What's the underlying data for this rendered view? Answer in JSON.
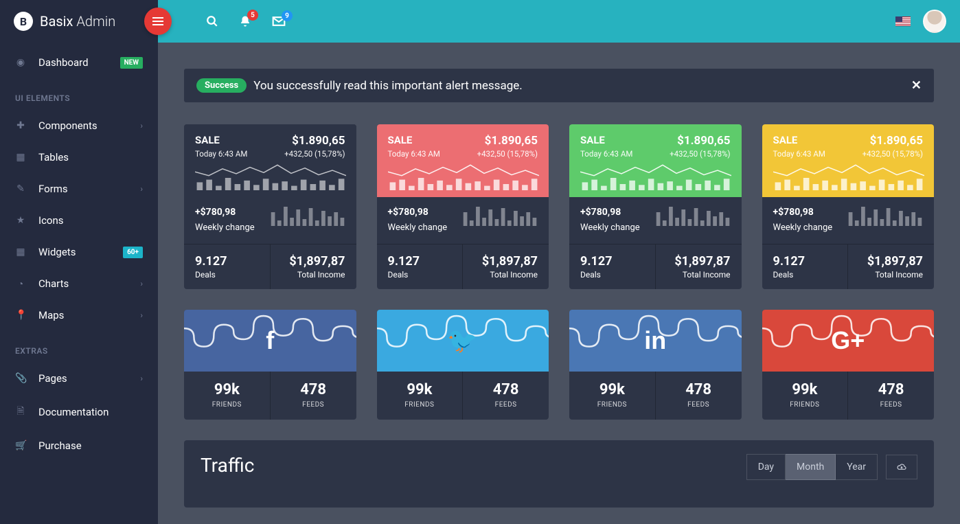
{
  "brand": {
    "name_bold": "Basix",
    "name_thin": "Admin"
  },
  "sidebar": {
    "items": [
      {
        "icon": "gauge-icon",
        "label": "Dashboard",
        "badge": "NEW",
        "badge_class": "badge-new",
        "chev": false
      }
    ],
    "section_ui": "UI ELEMENTS",
    "ui_items": [
      {
        "icon": "puzzle-icon",
        "label": "Components",
        "chev": true
      },
      {
        "icon": "table-icon",
        "label": "Tables",
        "chev": false
      },
      {
        "icon": "edit-icon",
        "label": "Forms",
        "chev": true
      },
      {
        "icon": "star-icon",
        "label": "Icons",
        "chev": false
      },
      {
        "icon": "grid-icon",
        "label": "Widgets",
        "badge": "60+",
        "badge_class": "badge-60",
        "chev": false
      },
      {
        "icon": "pie-icon",
        "label": "Charts",
        "chev": true
      },
      {
        "icon": "pin-icon",
        "label": "Maps",
        "chev": true
      }
    ],
    "section_extras": "EXTRAS",
    "extras_items": [
      {
        "icon": "clip-icon",
        "label": "Pages",
        "chev": true
      },
      {
        "icon": "doc-icon",
        "label": "Documentation",
        "chev": false
      },
      {
        "icon": "cart-icon",
        "label": "Purchase",
        "chev": false
      }
    ]
  },
  "topbar": {
    "notif_count": "5",
    "mail_count": "9"
  },
  "alert": {
    "pill": "Success",
    "text": "You successfully read this important alert message."
  },
  "sale": {
    "title": "SALE",
    "amount": "$1.890,65",
    "time": "Today 6:43 AM",
    "delta": "+432,50 (15,78%)",
    "weekly_change": "+$780,98",
    "weekly_label": "Weekly change",
    "deals_num": "9.127",
    "deals_label": "Deals",
    "income_num": "$1,897,87",
    "income_label": "Total Income"
  },
  "social": {
    "friends_num": "99k",
    "friends_label": "FRIENDS",
    "feeds_num": "478",
    "feeds_label": "FEEDS"
  },
  "traffic": {
    "title": "Traffic",
    "tabs": {
      "day": "Day",
      "month": "Month",
      "year": "Year"
    }
  },
  "chart_data": {
    "sale_sparkline": {
      "type": "line",
      "values": [
        30,
        20,
        38,
        25,
        42,
        28,
        48,
        26,
        40,
        22,
        34,
        20
      ],
      "ylim": [
        0,
        60
      ]
    },
    "sale_bars": {
      "type": "bar",
      "values": [
        9,
        12,
        5,
        14,
        7,
        11,
        6,
        13,
        8,
        10,
        5,
        12,
        7,
        11,
        6,
        13
      ],
      "ylim": [
        0,
        16
      ]
    },
    "weekly_bars": {
      "type": "bar",
      "values": [
        10,
        4,
        14,
        6,
        12,
        5,
        13,
        4,
        11,
        7,
        10,
        6
      ],
      "ylim": [
        0,
        16
      ]
    },
    "social_wave": {
      "type": "line",
      "values": [
        55,
        30,
        60,
        40,
        72,
        45,
        68,
        38,
        58,
        42
      ],
      "ylim": [
        0,
        90
      ]
    }
  }
}
